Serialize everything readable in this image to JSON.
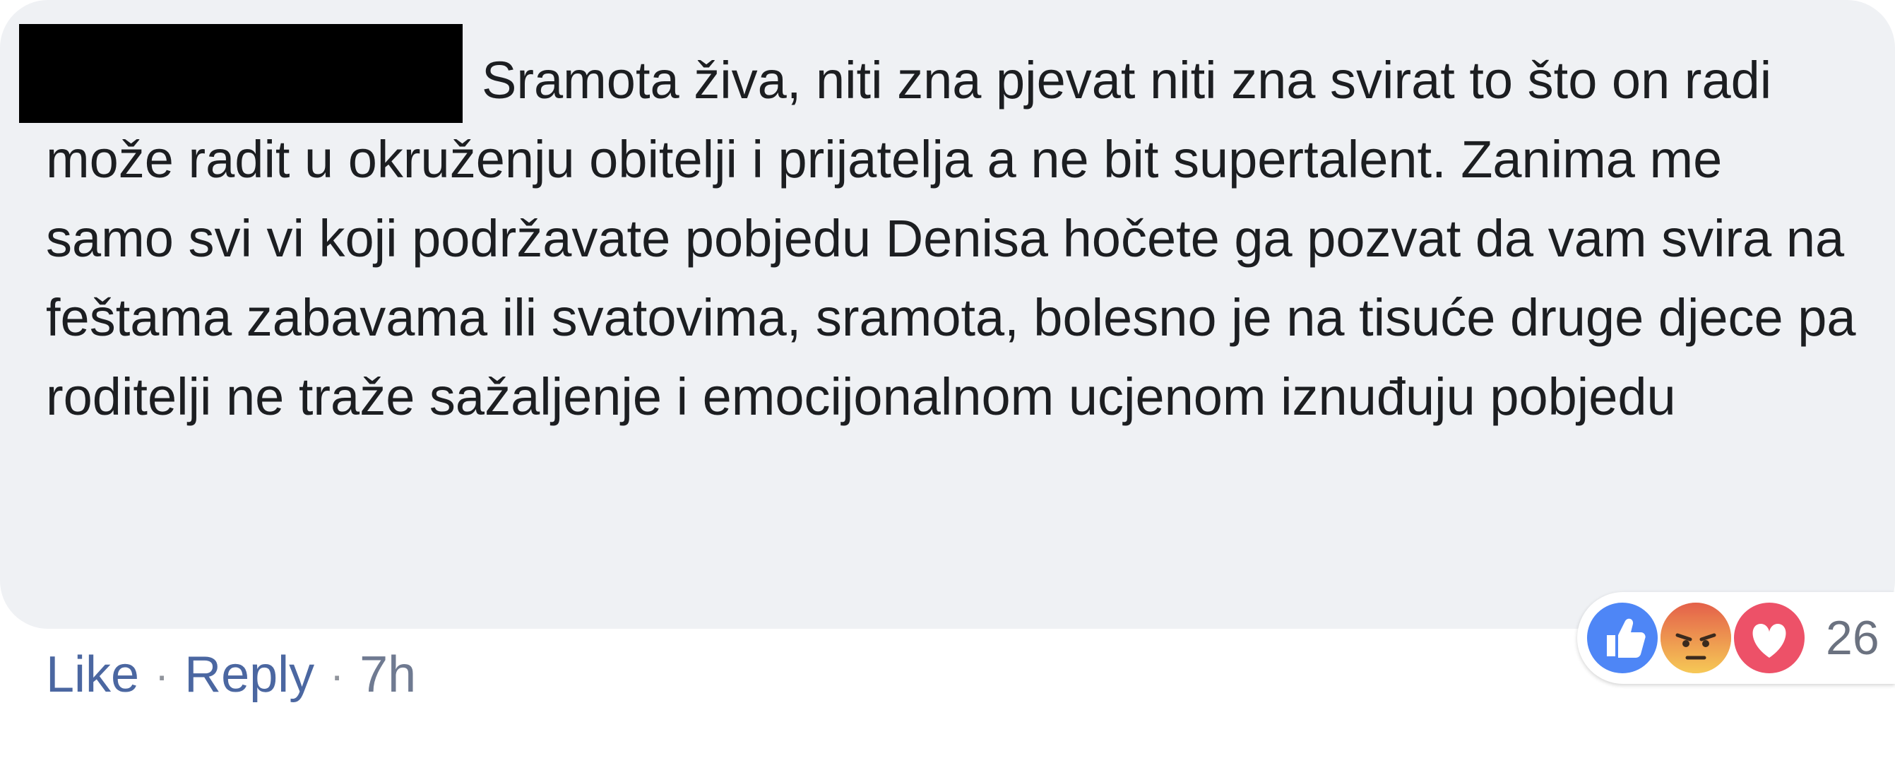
{
  "comment": {
    "text": "Sramota živa, niti zna pjevat niti zna svirat to što on radi može radit u okruženju obitelji i prijatelja a ne bit supertalent. Zanima me samo svi vi koji podržavate pobjedu Denisa hočete ga pozvat da vam svira na feštama zabavama ili svatovima, sramota, bolesno je na tisuće druge djece pa roditelji ne traže sažaljenje i emocijonalnom ucjenom iznuđuju pobjedu"
  },
  "actions": {
    "like_label": "Like",
    "reply_label": "Reply",
    "separator": "·",
    "timestamp": "7h"
  },
  "reactions": {
    "icons": [
      "like-icon",
      "angry-icon",
      "love-icon"
    ],
    "count": "26"
  },
  "colors": {
    "bubble_bg": "#eff1f4",
    "link": "#4b67a1",
    "like": "#4e86f6",
    "angry": "#f0a25f",
    "love": "#ed5168"
  }
}
